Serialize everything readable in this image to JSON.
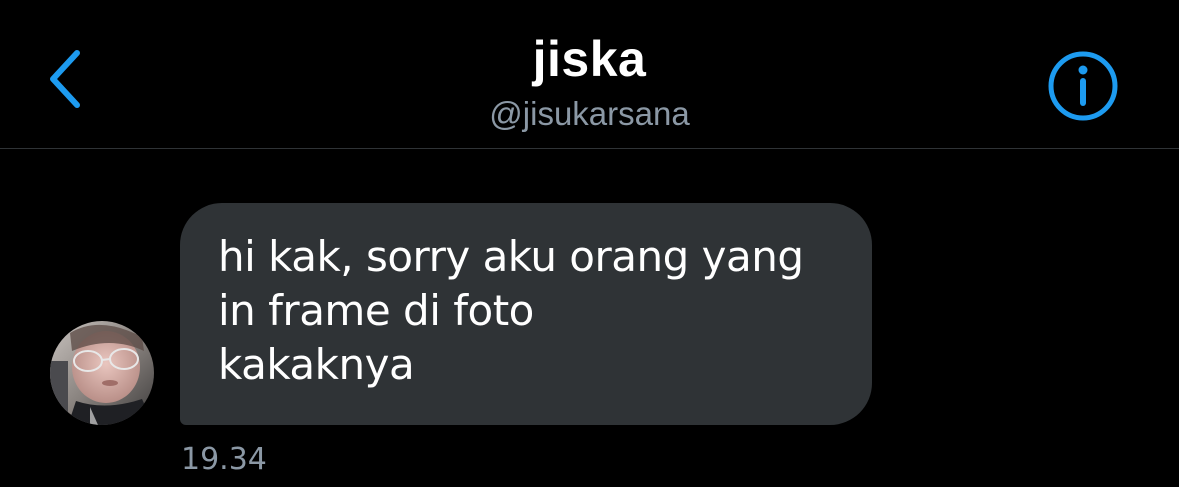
{
  "colors": {
    "background": "#000000",
    "accent": "#1d9bf0",
    "bubble": "#2f3336",
    "secondary_text": "#8b98a5",
    "divider": "#2f3336"
  },
  "header": {
    "back_icon": "chevron-left-icon",
    "title": "jiska",
    "handle": "@jisukarsana",
    "info_icon": "info-circle-icon"
  },
  "conversation": {
    "messages": [
      {
        "sender": "received",
        "lines": [
          "hi kak, sorry aku orang yang",
          "in frame di foto",
          "kakaknya"
        ],
        "time": "19.34"
      }
    ]
  }
}
